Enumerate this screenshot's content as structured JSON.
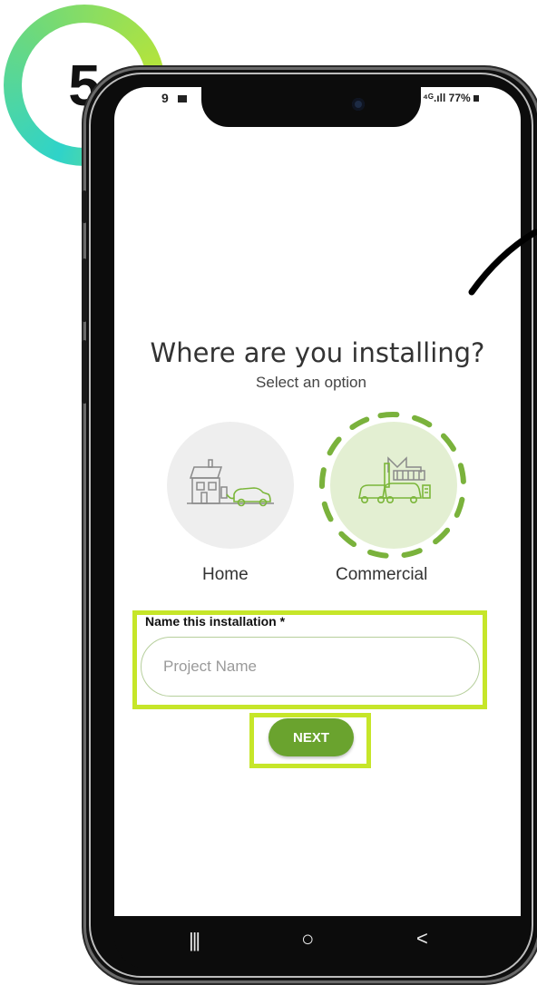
{
  "step": {
    "number": "5"
  },
  "status": {
    "time": "9",
    "signal": "⁴ᴳ.ıll",
    "battery": "77%"
  },
  "page": {
    "title": "Where are you installing?",
    "subtitle": "Select an option"
  },
  "options": [
    {
      "label": "Home",
      "icon": "house-with-car-charging-icon",
      "selected": false
    },
    {
      "label": "Commercial",
      "icon": "factory-with-vans-charging-icon",
      "selected": true
    }
  ],
  "form": {
    "name_label": "Name this installation *",
    "name_placeholder": "Project Name",
    "name_value": ""
  },
  "actions": {
    "next_label": "NEXT"
  },
  "navbar": {
    "recents": "|||",
    "home": "○",
    "back": "<"
  },
  "colors": {
    "accent_green": "#6aa32e",
    "highlight_lime": "#c6e629",
    "selected_fill": "#e3efd2",
    "badge_gradient": [
      "#2fd3c9",
      "#b6e43a"
    ]
  }
}
